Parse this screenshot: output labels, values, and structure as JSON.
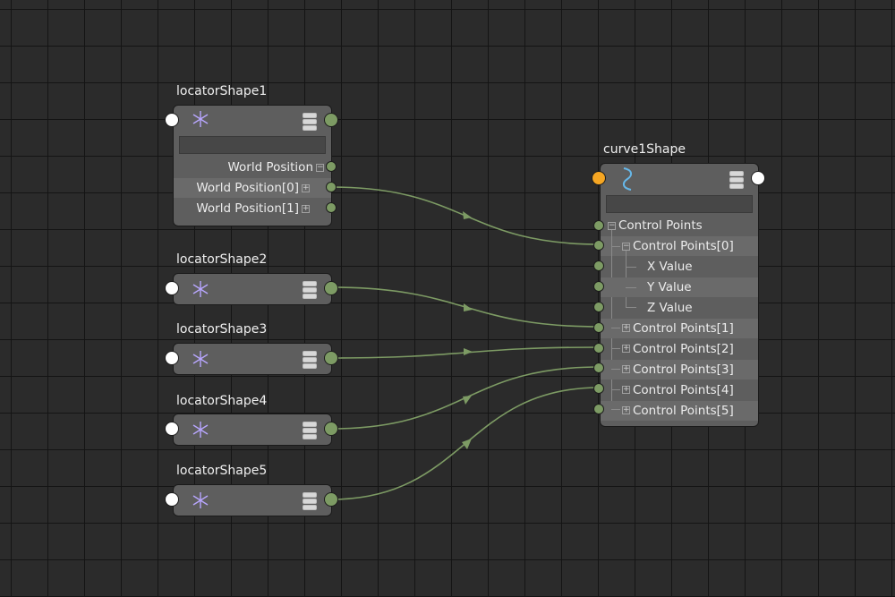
{
  "colors": {
    "background": "#2b2b2b",
    "grid": "#141414",
    "node": "#5e5e5e",
    "wire": "#7d9b64",
    "input_plug": "#ffffff",
    "orange_plug": "#f5a623"
  },
  "locators": [
    {
      "name": "locatorShape1",
      "attrs": [
        "World Position",
        "World Position[0]",
        "World Position[1]"
      ]
    },
    {
      "name": "locatorShape2"
    },
    {
      "name": "locatorShape3"
    },
    {
      "name": "locatorShape4"
    },
    {
      "name": "locatorShape5"
    }
  ],
  "curve": {
    "name": "curve1Shape",
    "attrs": [
      "Control Points",
      "Control Points[0]",
      "X Value",
      "Y Value",
      "Z Value",
      "Control Points[1]",
      "Control Points[2]",
      "Control Points[3]",
      "Control Points[4]",
      "Control Points[5]"
    ]
  },
  "icons": {
    "locator": "locator-star-icon",
    "curve": "curve-icon",
    "node_menu": "stack-icon"
  }
}
